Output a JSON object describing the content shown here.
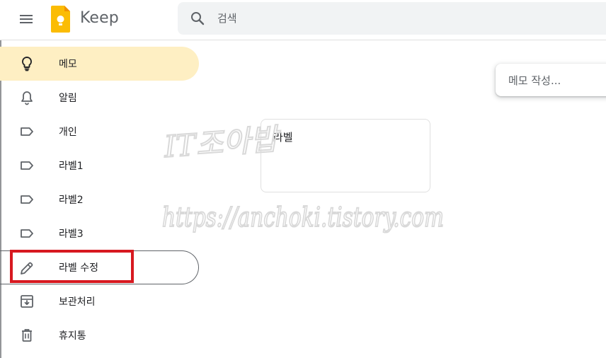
{
  "header": {
    "app_title": "Keep",
    "search_placeholder": "검색"
  },
  "sidebar": {
    "items": [
      {
        "label": "메모",
        "icon": "lightbulb-icon",
        "active": true
      },
      {
        "label": "알림",
        "icon": "bell-icon"
      },
      {
        "label": "개인",
        "icon": "label-icon"
      },
      {
        "label": "라벨1",
        "icon": "label-icon"
      },
      {
        "label": "라벨2",
        "icon": "label-icon"
      },
      {
        "label": "라벨3",
        "icon": "label-icon"
      },
      {
        "label": "라벨 수정",
        "icon": "pencil-icon",
        "highlighted": true
      },
      {
        "label": "보관처리",
        "icon": "archive-icon"
      },
      {
        "label": "휴지통",
        "icon": "trash-icon"
      }
    ]
  },
  "main": {
    "take_note_placeholder": "메모 작성...",
    "notes": [
      {
        "title": "라벨"
      }
    ]
  },
  "watermark": {
    "line1": "IT조아밥",
    "line2": "https://anchoki.tistory.com"
  },
  "colors": {
    "active_bg": "#feefc3",
    "highlight_red": "#d71920",
    "logo_yellow": "#fbbc04"
  }
}
